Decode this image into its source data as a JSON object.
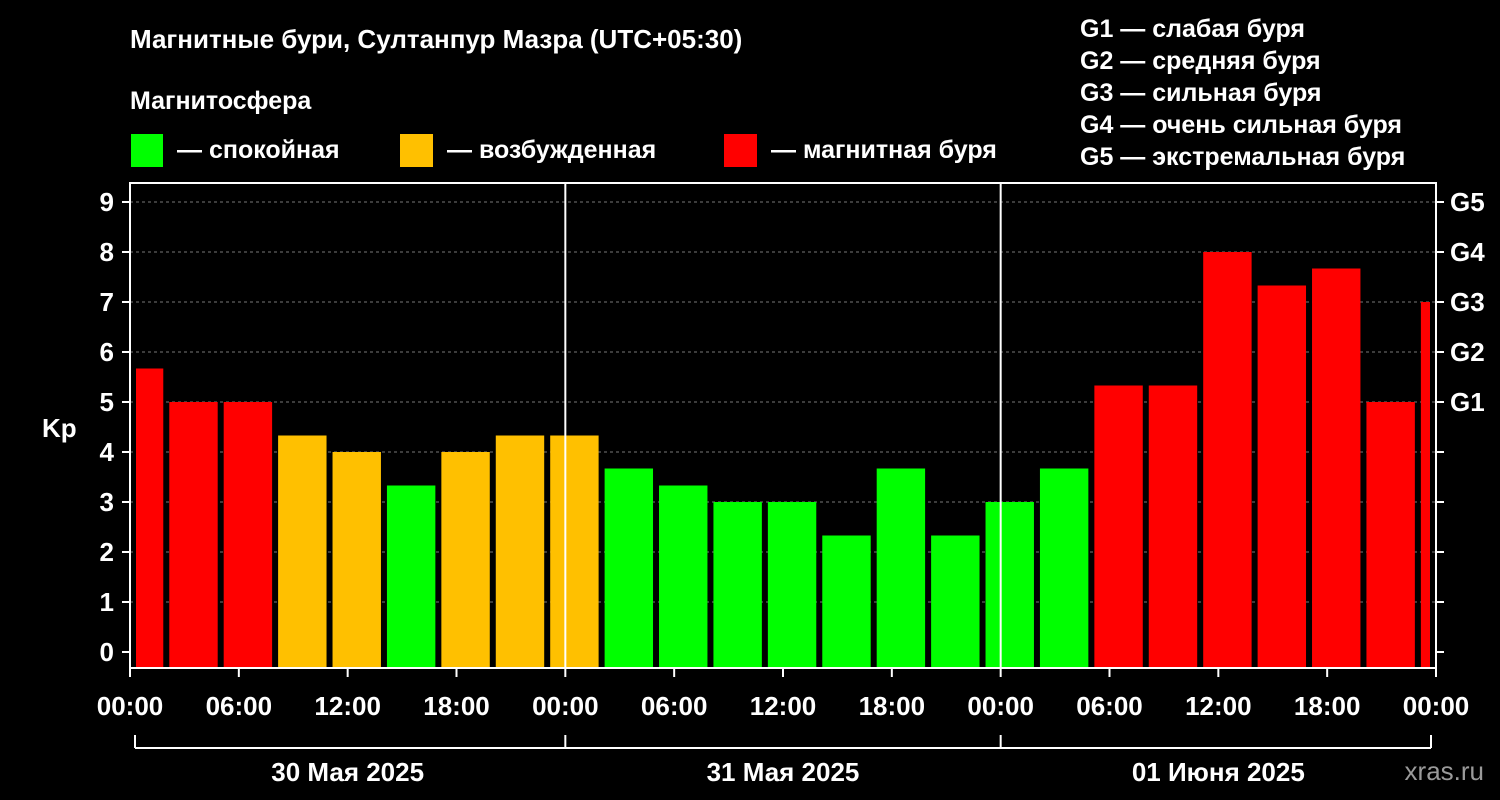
{
  "title": "Магнитные бури, Султанпур Мазра (UTC+05:30)",
  "legend": {
    "heading": "Магнитосфера",
    "items": [
      {
        "label": "— спокойная",
        "color": "#00ff00"
      },
      {
        "label": "— возбужденная",
        "color": "#ffc000"
      },
      {
        "label": "— магнитная буря",
        "color": "#ff0000"
      }
    ]
  },
  "g_scale": [
    "G1 — слабая буря",
    "G2 — средняя буря",
    "G3 — сильная буря",
    "G4 — очень сильная буря",
    "G5 — экстремальная буря"
  ],
  "watermark": "xras.ru",
  "chart_data": {
    "type": "bar",
    "ylabel": "Kp",
    "ylim": [
      0,
      9
    ],
    "y_ticks": [
      "0",
      "1",
      "2",
      "3",
      "4",
      "5",
      "6",
      "7",
      "8",
      "9"
    ],
    "right_ticks": [
      {
        "kp": 5,
        "label": "G1"
      },
      {
        "kp": 6,
        "label": "G2"
      },
      {
        "kp": 7,
        "label": "G3"
      },
      {
        "kp": 8,
        "label": "G4"
      },
      {
        "kp": 9,
        "label": "G5"
      }
    ],
    "x_tick_labels": [
      "00:00",
      "06:00",
      "12:00",
      "18:00",
      "00:00",
      "06:00",
      "12:00",
      "18:00",
      "00:00",
      "06:00",
      "12:00",
      "18:00",
      "00:00"
    ],
    "days": [
      "30 Мая 2025",
      "31 Мая 2025",
      "01 Июня 2025"
    ],
    "grid": "dashed horizontal",
    "colors": {
      "quiet": "#00ff00",
      "active": "#ffc000",
      "storm": "#ff0000"
    },
    "bars": [
      {
        "hours": [
          0,
          2
        ],
        "kp": 5.67,
        "level": "storm"
      },
      {
        "hours": [
          2,
          5
        ],
        "kp": 5.0,
        "level": "storm"
      },
      {
        "hours": [
          5,
          8
        ],
        "kp": 5.0,
        "level": "storm"
      },
      {
        "hours": [
          8,
          11
        ],
        "kp": 4.33,
        "level": "active"
      },
      {
        "hours": [
          11,
          14
        ],
        "kp": 4.0,
        "level": "active"
      },
      {
        "hours": [
          14,
          17
        ],
        "kp": 3.33,
        "level": "quiet"
      },
      {
        "hours": [
          17,
          20
        ],
        "kp": 4.0,
        "level": "active"
      },
      {
        "hours": [
          20,
          23
        ],
        "kp": 4.33,
        "level": "active"
      },
      {
        "hours": [
          23,
          26
        ],
        "kp": 4.33,
        "level": "active"
      },
      {
        "hours": [
          26,
          29
        ],
        "kp": 3.67,
        "level": "quiet"
      },
      {
        "hours": [
          29,
          32
        ],
        "kp": 3.33,
        "level": "quiet"
      },
      {
        "hours": [
          32,
          35
        ],
        "kp": 3.0,
        "level": "quiet"
      },
      {
        "hours": [
          35,
          38
        ],
        "kp": 3.0,
        "level": "quiet"
      },
      {
        "hours": [
          38,
          41
        ],
        "kp": 2.33,
        "level": "quiet"
      },
      {
        "hours": [
          41,
          44
        ],
        "kp": 3.67,
        "level": "quiet"
      },
      {
        "hours": [
          44,
          47
        ],
        "kp": 2.33,
        "level": "quiet"
      },
      {
        "hours": [
          47,
          50
        ],
        "kp": 3.0,
        "level": "quiet"
      },
      {
        "hours": [
          50,
          53
        ],
        "kp": 3.67,
        "level": "quiet"
      },
      {
        "hours": [
          53,
          56
        ],
        "kp": 5.33,
        "level": "storm"
      },
      {
        "hours": [
          56,
          59
        ],
        "kp": 5.33,
        "level": "storm"
      },
      {
        "hours": [
          59,
          62
        ],
        "kp": 8.0,
        "level": "storm"
      },
      {
        "hours": [
          62,
          65
        ],
        "kp": 7.33,
        "level": "storm"
      },
      {
        "hours": [
          65,
          68
        ],
        "kp": 7.67,
        "level": "storm"
      },
      {
        "hours": [
          68,
          71
        ],
        "kp": 5.0,
        "level": "storm"
      },
      {
        "hours": [
          71,
          72
        ],
        "kp": 7.0,
        "level": "storm"
      }
    ]
  }
}
